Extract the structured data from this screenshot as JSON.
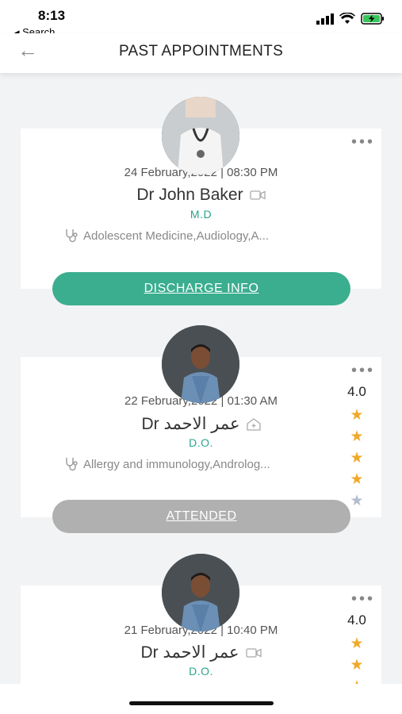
{
  "status_bar": {
    "time": "8:13",
    "back_app": "◂ Search"
  },
  "header": {
    "title": "PAST APPOINTMENTS"
  },
  "appointments": [
    {
      "date": "24 February,2022 | 08:30 PM",
      "name": "Dr John Baker",
      "mode": "video",
      "degree": "M.D",
      "specialties": "Adolescent Medicine,Audiology,A...",
      "action": "DISCHARGE INFO",
      "action_color": "#3bae8f"
    },
    {
      "date": "22 February,2022 | 01:30 AM",
      "name": "Dr عمر الاحمد",
      "mode": "clinic",
      "degree": "D.O.",
      "specialties": "Allergy and immunology,Androlog...",
      "rating": "4.0",
      "rating_fraction": 0.8,
      "action": "ATTENDED",
      "action_color": "#b0b0b0"
    },
    {
      "date": "21 February,2022 | 10:40 PM",
      "name": "Dr عمر الاحمد",
      "mode": "video",
      "degree": "D.O.",
      "rating": "4.0",
      "rating_fraction": 0.8
    }
  ]
}
